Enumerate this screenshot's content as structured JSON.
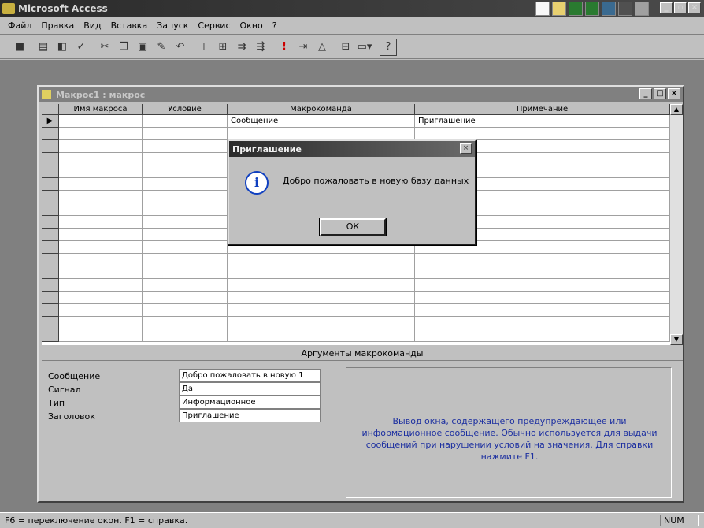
{
  "app": {
    "title": "Microsoft Access"
  },
  "menu": [
    "Файл",
    "Правка",
    "Вид",
    "Вставка",
    "Запуск",
    "Сервис",
    "Окно",
    "?"
  ],
  "macro_window": {
    "title": "Макрос1 : макрос"
  },
  "grid": {
    "columns": [
      "Имя макроса",
      "Условие",
      "Макрокоманда",
      "Примечание"
    ],
    "rows": [
      {
        "name": "",
        "condition": "",
        "action": "Сообщение",
        "note": "Приглашение"
      }
    ],
    "empty_rows": 17
  },
  "args": {
    "header": "Аргументы макрокоманды",
    "items": [
      {
        "label": "Сообщение",
        "value": "Добро пожаловать в новую 1"
      },
      {
        "label": "Сигнал",
        "value": "Да"
      },
      {
        "label": "Тип",
        "value": "Информационное"
      },
      {
        "label": "Заголовок",
        "value": "Приглашение"
      }
    ],
    "help": "Вывод окна, содержащего предупреждающее или информационное сообщение. Обычно используется для выдачи сообщений при нарушении условий на значения. Для справки нажмите F1."
  },
  "dialog": {
    "title": "Приглашение",
    "message": "Добро пожаловать в новую базу данных",
    "ok": "ОК"
  },
  "status": {
    "text": "F6 = переключение окон. F1 = справка.",
    "indicator": "NUM"
  },
  "colors": {
    "help_text": "#1c2fa0",
    "workspace": "#808080"
  }
}
